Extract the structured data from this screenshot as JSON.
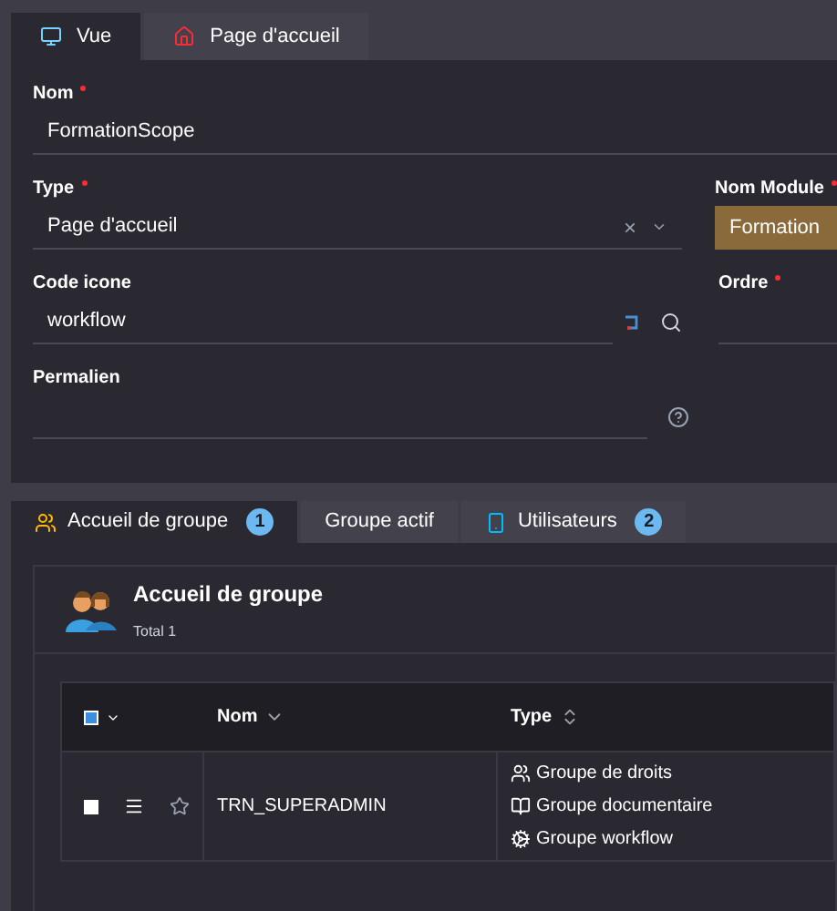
{
  "tabs": [
    {
      "label": "Vue",
      "kind": "monitor",
      "selected": true
    },
    {
      "label": "Page d'accueil",
      "kind": "house",
      "selected": false
    }
  ],
  "form": {
    "nom": {
      "label": "Nom",
      "required": true,
      "value": "FormationScope"
    },
    "type": {
      "label": "Type",
      "required": true,
      "value": "Page d'accueil",
      "clear": "×"
    },
    "nom_module": {
      "label": "Nom Module",
      "required": true,
      "value": "Formation"
    },
    "code_icone": {
      "label": "Code icone",
      "required": false,
      "value": "workflow"
    },
    "ordre": {
      "label": "Ordre",
      "required": true
    },
    "permalien": {
      "label": "Permalien",
      "required": false
    }
  },
  "subtabs": [
    {
      "label": "Accueil de groupe",
      "kind": "people",
      "badge": "1",
      "selected": true
    },
    {
      "label": "Groupe actif",
      "selected": false
    },
    {
      "label": "Utilisateurs",
      "kind": "phone",
      "badge": "2",
      "selected": false
    }
  ],
  "group": {
    "title": "Accueil de groupe",
    "total": "Total 1",
    "table": {
      "select_all_checked": true,
      "columns": [
        {
          "label": "Nom",
          "kind": "desc"
        },
        {
          "label": "Type",
          "kind": "both"
        }
      ],
      "rows": [
        {
          "checked": false,
          "starred": false,
          "nom": "TRN_SUPERADMIN",
          "types": [
            {
              "kind": "users",
              "label": "Groupe de droits"
            },
            {
              "kind": "book",
              "label": "Groupe documentaire"
            },
            {
              "kind": "cogs",
              "label": "Groupe workflow"
            }
          ]
        }
      ]
    }
  }
}
